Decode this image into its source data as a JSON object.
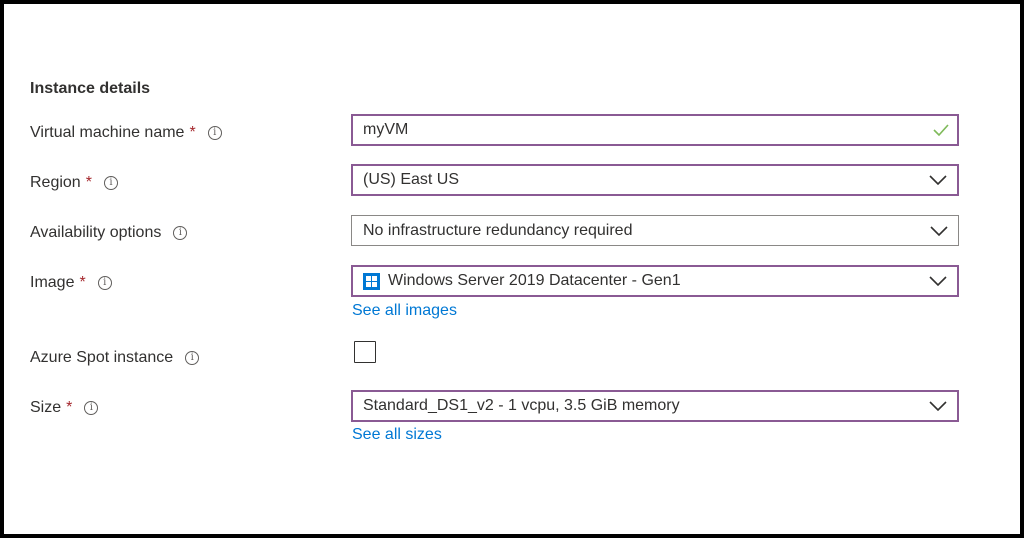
{
  "section": {
    "title": "Instance details"
  },
  "required_marker": "*",
  "info_glyph": "i",
  "fields": {
    "vm_name": {
      "label": "Virtual machine name",
      "value": "myVM"
    },
    "region": {
      "label": "Region",
      "value": "(US) East US"
    },
    "availability": {
      "label": "Availability options",
      "value": "No infrastructure redundancy required"
    },
    "image": {
      "label": "Image",
      "value": "Windows Server 2019 Datacenter - Gen1",
      "link": "See all images"
    },
    "spot": {
      "label": "Azure Spot instance",
      "checked": false
    },
    "size": {
      "label": "Size",
      "value": "Standard_DS1_v2 - 1 vcpu, 3.5 GiB memory",
      "link": "See all sizes"
    }
  },
  "colors": {
    "focus_border": "#8a5a94",
    "required": "#a4262c",
    "link": "#0078d4",
    "valid_check": "#7fba5a",
    "windows_logo": "#0078d4"
  },
  "icons": [
    "info-icon",
    "checkmark-icon",
    "chevron-down-icon",
    "windows-logo-icon"
  ]
}
